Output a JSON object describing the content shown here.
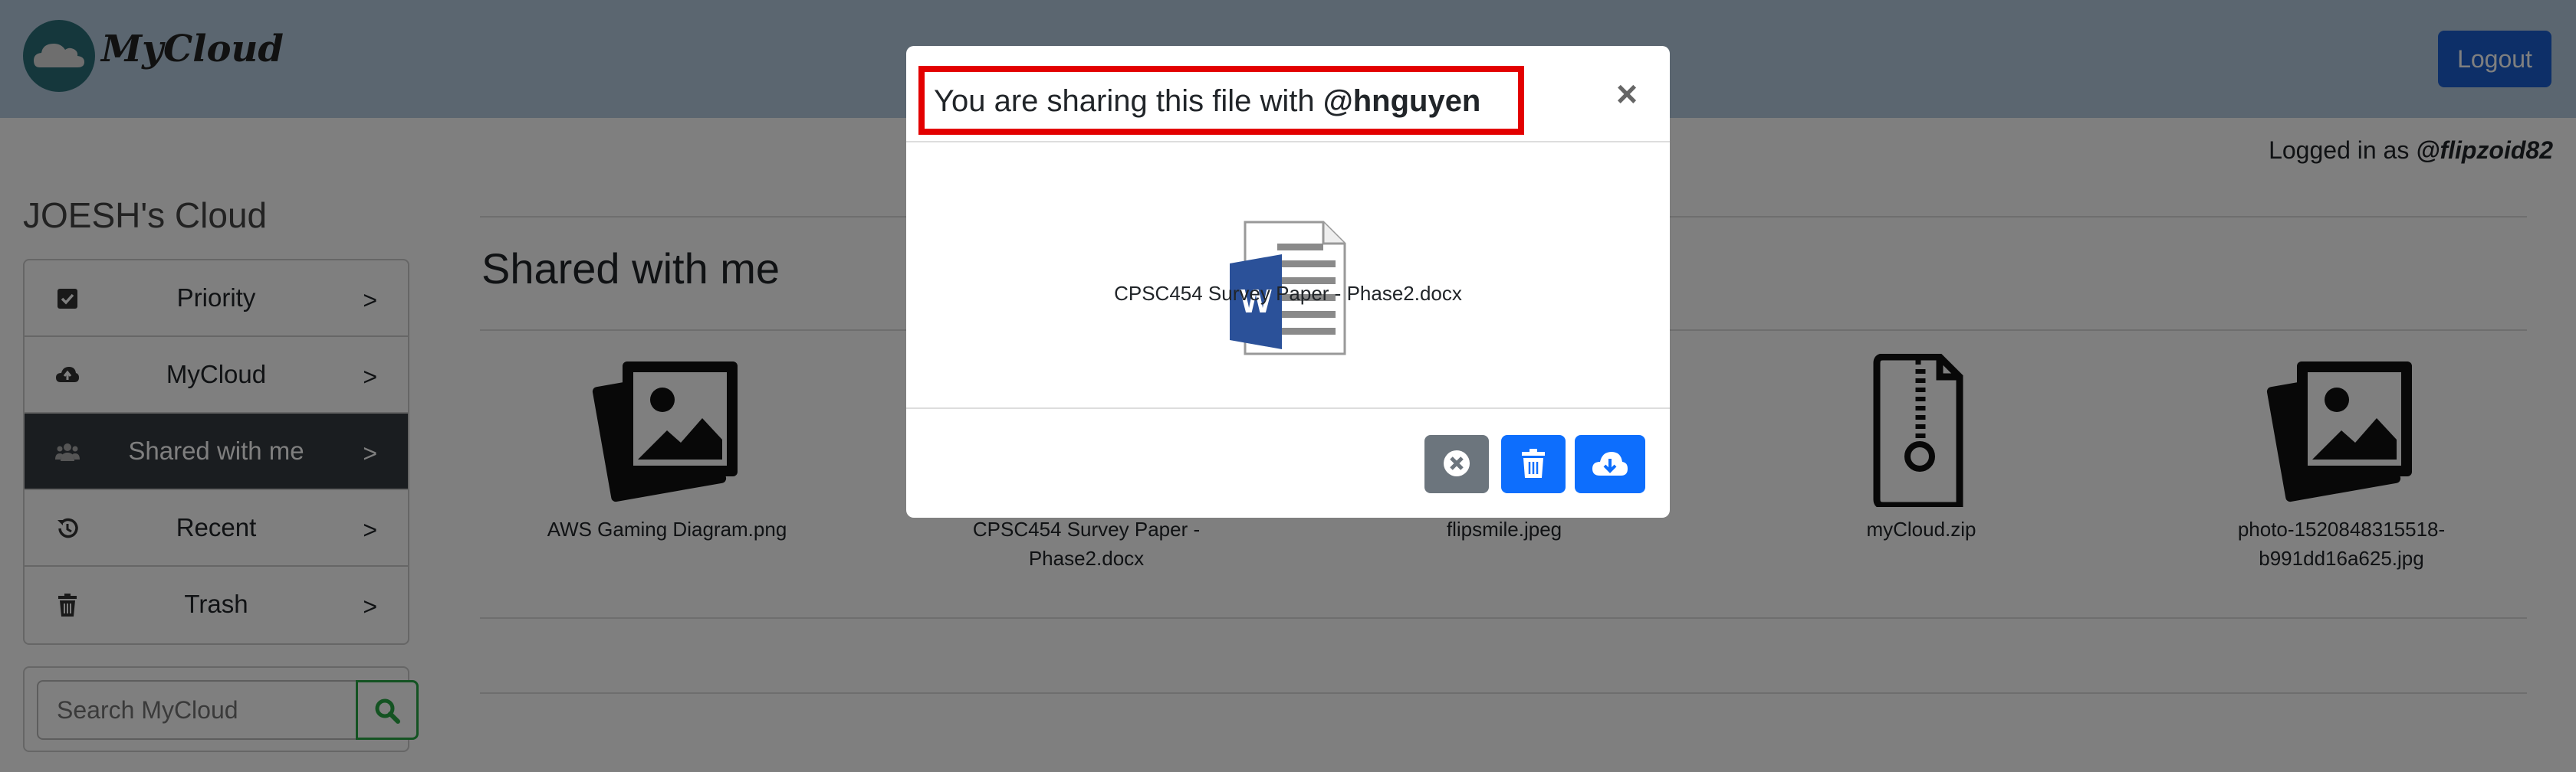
{
  "app": {
    "name": "MyCloud",
    "logout_label": "Logout",
    "logged_in_prefix": "Logged in as ",
    "username": "@flipzoid82"
  },
  "sidebar": {
    "title": "JOESH's Cloud",
    "items": [
      {
        "label": "Priority",
        "icon": "checkbox-icon",
        "arrow": ">"
      },
      {
        "label": "MyCloud",
        "icon": "cloud-upload-icon",
        "arrow": ">"
      },
      {
        "label": "Shared with me",
        "icon": "users-icon",
        "arrow": ">",
        "active": true
      },
      {
        "label": "Recent",
        "icon": "history-icon",
        "arrow": ">"
      },
      {
        "label": "Trash",
        "icon": "trash-icon",
        "arrow": ">"
      }
    ],
    "search_placeholder": "Search MyCloud"
  },
  "main": {
    "title": "Shared with me",
    "files": [
      {
        "name": "AWS Gaming Diagram.png",
        "icon": "image-file-icon"
      },
      {
        "name": "CPSC454 Survey Paper - Phase2.docx",
        "icon": "document-file-icon"
      },
      {
        "name": "flipsmile.jpeg",
        "icon": "image-file-icon"
      },
      {
        "name": "myCloud.zip",
        "icon": "zip-file-icon"
      },
      {
        "name": "photo-1520848315518-b991dd16a625.jpg",
        "icon": "image-file-icon"
      }
    ]
  },
  "modal": {
    "title_prefix": "You are sharing this file with ",
    "title_user": "@hnguyen",
    "close_symbol": "×",
    "file_name": "CPSC454 Survey Paper - Phase2.docx",
    "word_letter": "W",
    "buttons": [
      "cancel-icon",
      "trash-icon",
      "cloud-download-icon"
    ]
  },
  "colors": {
    "nav_bg": "#b6cce0",
    "primary": "#0d6efd",
    "dark": "#343a40",
    "highlight": "#e30000",
    "success": "#28a745"
  }
}
